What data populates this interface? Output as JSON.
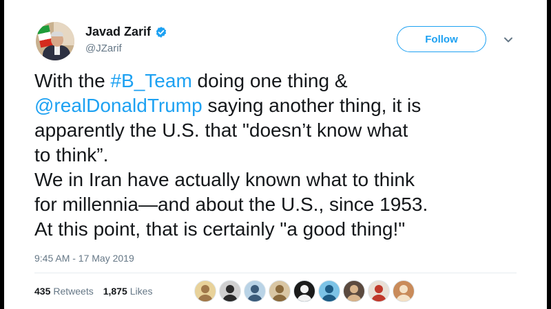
{
  "author": {
    "display_name": "Javad Zarif",
    "handle": "@JZarif",
    "verified": true
  },
  "follow_label": "Follow",
  "tweet": {
    "lines": [
      [
        {
          "t": "With the ",
          "k": "text"
        },
        {
          "t": "#B_Team",
          "k": "hashtag"
        },
        {
          "t": " doing one thing &",
          "k": "text"
        }
      ],
      [
        {
          "t": "@realDonaldTrump",
          "k": "mention"
        },
        {
          "t": " saying another thing, it is",
          "k": "text"
        }
      ],
      [
        {
          "t": "apparently the U.S. that \"doesn’t know what",
          "k": "text"
        }
      ],
      [
        {
          "t": "to think”.",
          "k": "text"
        }
      ],
      [
        {
          "t": "We in Iran have actually known what to think",
          "k": "text"
        }
      ],
      [
        {
          "t": "for millennia—and about the U.S., since 1953.",
          "k": "text"
        }
      ],
      [
        {
          "t": "At this point, that is certainly \"a good thing!\"",
          "k": "text"
        }
      ]
    ]
  },
  "timestamp": "9:45 AM - 17 May 2019",
  "stats": {
    "retweets_count": "435",
    "retweets_label": "Retweets",
    "likes_count": "1,875",
    "likes_label": "Likes"
  },
  "likers": [
    {
      "name": "liker-avatar-1",
      "bg": "#e8d29a",
      "fg": "#a0784a"
    },
    {
      "name": "liker-avatar-2",
      "bg": "#cfcfcf",
      "fg": "#2a2a2a"
    },
    {
      "name": "liker-avatar-3",
      "bg": "#b9d3e6",
      "fg": "#3b5b7a"
    },
    {
      "name": "liker-avatar-4",
      "bg": "#d9c6a3",
      "fg": "#8a6a3c"
    },
    {
      "name": "liker-avatar-5",
      "bg": "#1b1b1b",
      "fg": "#f2f2f2"
    },
    {
      "name": "liker-avatar-6",
      "bg": "#7cc3e6",
      "fg": "#1d5c85"
    },
    {
      "name": "liker-avatar-7",
      "bg": "#5b4a3f",
      "fg": "#d8b48c"
    },
    {
      "name": "liker-avatar-8",
      "bg": "#e9e0d6",
      "fg": "#c0392b"
    },
    {
      "name": "liker-avatar-9",
      "bg": "#c98b5a",
      "fg": "#f4e2c8"
    }
  ],
  "colors": {
    "accent": "#1da1f2",
    "text": "#14171a",
    "muted": "#657786"
  },
  "icons": {
    "verified": "verified-badge-icon",
    "menu": "chevron-down-icon"
  }
}
